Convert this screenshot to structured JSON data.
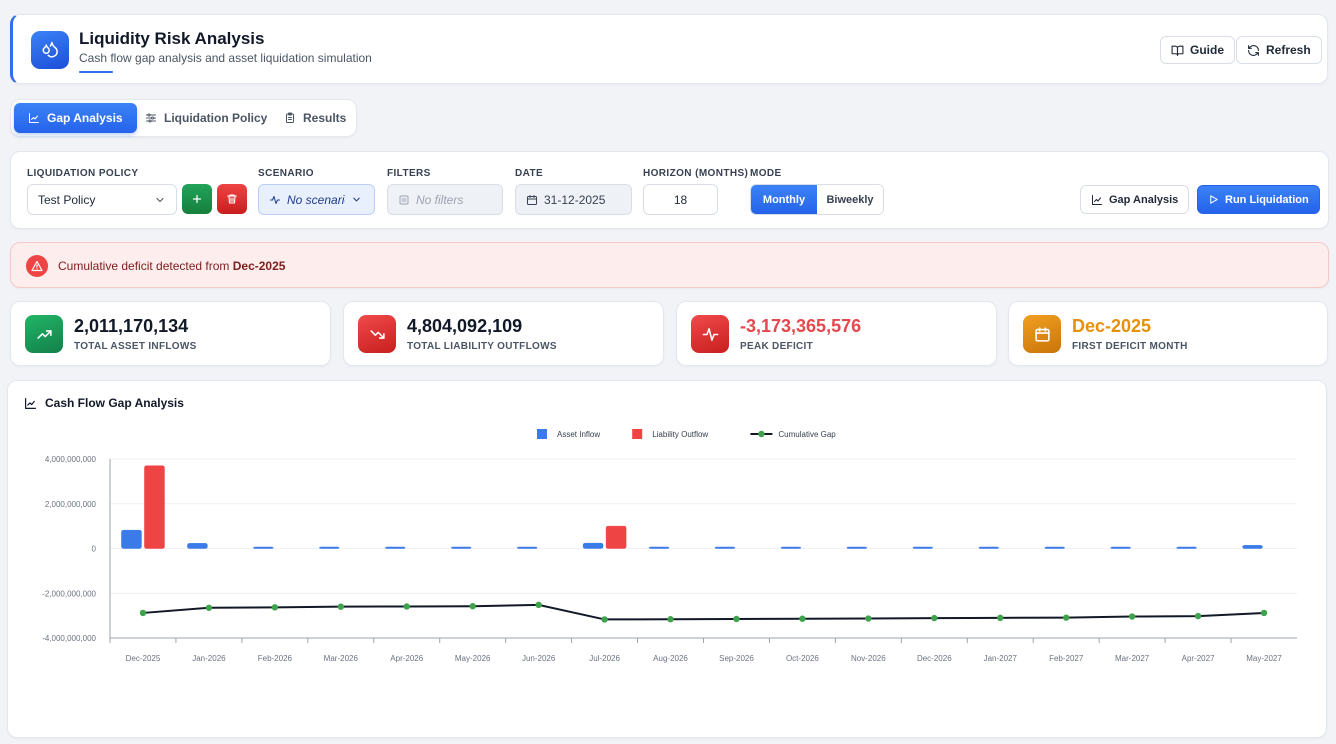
{
  "header": {
    "title": "Liquidity Risk Analysis",
    "subtitle": "Cash flow gap analysis and asset liquidation simulation",
    "guide_label": "Guide",
    "refresh_label": "Refresh",
    "logo_icon": "droplets-icon",
    "accent": "#2f6fec"
  },
  "tabs": [
    {
      "label": "Gap Analysis",
      "icon": "chart-icon",
      "active": true
    },
    {
      "label": "Liquidation Policy",
      "icon": "sliders-icon",
      "active": false
    },
    {
      "label": "Results",
      "icon": "clipboard-icon",
      "active": false
    }
  ],
  "controls": {
    "policy_label": "LIQUIDATION POLICY",
    "policy_value": "Test Policy",
    "scenario_label": "SCENARIO",
    "scenario_value": "No scenario",
    "filters_label": "FILTERS",
    "filters_placeholder": "No filters",
    "date_label": "DATE",
    "date_value": "31-12-2025",
    "horizon_label": "HORIZON (MONTHS)",
    "horizon_value": "18",
    "mode_label": "MODE",
    "mode_options": [
      "Monthly",
      "Biweekly"
    ],
    "mode_selected": "Monthly",
    "gap_button": "Gap Analysis",
    "run_button": "Run Liquidation"
  },
  "alert": {
    "text": "Cumulative deficit detected from ",
    "month": "Dec-2025"
  },
  "stats": [
    {
      "value": "2,011,170,134",
      "label": "TOTAL ASSET INFLOWS",
      "color": "#111827",
      "icon": "trending-up-icon"
    },
    {
      "value": "4,804,092,109",
      "label": "TOTAL LIABILITY OUTFLOWS",
      "color": "#111827",
      "icon": "trending-down-icon"
    },
    {
      "value": "-3,173,365,576",
      "label": "PEAK DEFICIT",
      "color": "#e5484d",
      "icon": "activity-icon"
    },
    {
      "value": "Dec-2025",
      "label": "FIRST DEFICIT MONTH",
      "color": "#e8900c",
      "icon": "calendar-icon"
    }
  ],
  "chart": {
    "title": "Cash Flow Gap Analysis"
  },
  "chart_data": {
    "type": "bar",
    "categories": [
      "Dec-2025",
      "Jan-2026",
      "Feb-2026",
      "Mar-2026",
      "Apr-2026",
      "May-2026",
      "Jun-2026",
      "Jul-2026",
      "Aug-2026",
      "Sep-2026",
      "Oct-2026",
      "Nov-2026",
      "Dec-2026",
      "Jan-2027",
      "Feb-2027",
      "Mar-2027",
      "Apr-2027",
      "May-2027"
    ],
    "series": [
      {
        "name": "Asset Inflow",
        "type": "bar",
        "color": "#3b7be9",
        "values": [
          820000000,
          230000000,
          20000000,
          30000000,
          15000000,
          15000000,
          60000000,
          240000000,
          10000000,
          20000000,
          8000000,
          8000000,
          25000000,
          5000000,
          10000000,
          50000000,
          25000000,
          140000000
        ]
      },
      {
        "name": "Liability Outflow",
        "type": "bar",
        "color": "#ef4444",
        "values": [
          3700000000,
          0,
          0,
          0,
          0,
          0,
          0,
          1000000000,
          0,
          0,
          0,
          0,
          0,
          0,
          0,
          0,
          0,
          0
        ]
      },
      {
        "name": "Cumulative Gap",
        "type": "line",
        "color": "#111827",
        "marker_color": "#3fa34d",
        "values": [
          -2880000000,
          -2650000000,
          -2630000000,
          -2600000000,
          -2590000000,
          -2580000000,
          -2520000000,
          -3170000000,
          -3160000000,
          -3150000000,
          -3140000000,
          -3130000000,
          -3110000000,
          -3100000000,
          -3090000000,
          -3040000000,
          -3020000000,
          -2880000000
        ]
      }
    ],
    "y_ticks": [
      "4,000,000,000",
      "2,000,000,000",
      "0",
      "-2,000,000,000",
      "-4,000,000,000"
    ],
    "ylim": [
      -4000000000,
      4000000000
    ],
    "legend_position": "top-center",
    "grid": true
  }
}
